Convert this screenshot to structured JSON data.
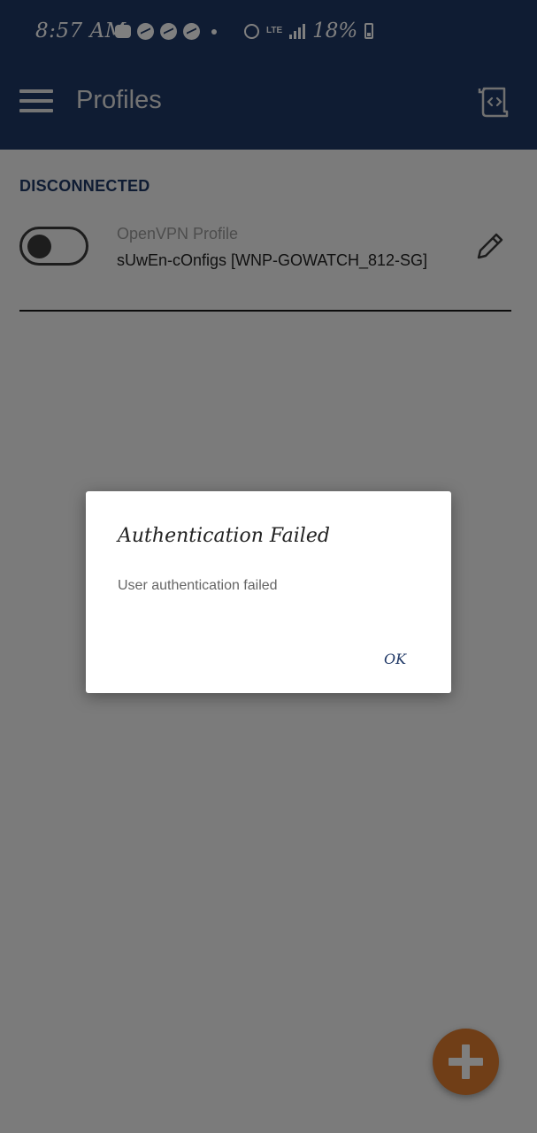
{
  "status_bar": {
    "time": "8:57 AM",
    "network": "LTE",
    "battery": "18%"
  },
  "toolbar": {
    "title": "Profiles"
  },
  "section": {
    "status_label": "DISCONNECTED"
  },
  "profile": {
    "type": "OpenVPN Profile",
    "name": "sUwEn-cOnfigs [WNP-GOWATCH_812-SG]",
    "connected": false
  },
  "dialog": {
    "title": "Authentication Failed",
    "message": "User authentication failed",
    "ok_label": "OK"
  },
  "colors": {
    "primary": "#1f3866",
    "accent": "#e07d2e",
    "background": "#f6f6f6"
  },
  "icons": {
    "menu": "hamburger-icon",
    "import": "import-file-icon",
    "edit": "pencil-icon",
    "fab": "plus-icon"
  }
}
